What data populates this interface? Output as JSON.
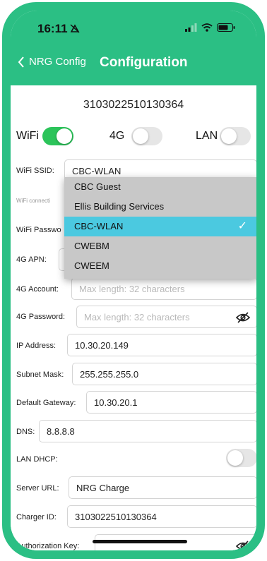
{
  "status": {
    "time": "16:11"
  },
  "nav": {
    "back_label": "NRG Config",
    "title": "Configuration"
  },
  "device_id": "3103022510130364",
  "toggles": {
    "wifi_label": "WiFi",
    "g4_label": "4G",
    "lan_label": "LAN",
    "wifi_on": true,
    "g4_on": false,
    "lan_on": false
  },
  "wifi_ssid": {
    "label": "WiFi SSID:",
    "value": "CBC-WLAN"
  },
  "wifi_note": "WiFi connecti",
  "wifi_password": {
    "label": "WiFi Passwo"
  },
  "g4_apn": {
    "label": "4G APN:"
  },
  "ssid_options": [
    {
      "label": "CBC Guest",
      "selected": false
    },
    {
      "label": "Ellis Building Services",
      "selected": false
    },
    {
      "label": "CBC-WLAN",
      "selected": true
    },
    {
      "label": "CWEBM",
      "selected": false
    },
    {
      "label": "CWEEM",
      "selected": false
    }
  ],
  "g4_account": {
    "label": "4G Account:",
    "placeholder": "Max length: 32 characters"
  },
  "g4_password": {
    "label": "4G Password:",
    "placeholder": "Max length: 32 characters"
  },
  "ip_address": {
    "label": "IP Address:",
    "value": "10.30.20.149"
  },
  "subnet_mask": {
    "label": "Subnet Mask:",
    "value": "255.255.255.0"
  },
  "default_gateway": {
    "label": "Default Gateway:",
    "value": "10.30.20.1"
  },
  "dns": {
    "label": "DNS:",
    "value": "8.8.8.8"
  },
  "lan_dhcp": {
    "label": "LAN DHCP:",
    "on": false
  },
  "server_url": {
    "label": "Server URL:",
    "value": "NRG Charge"
  },
  "charger_id": {
    "label": "Charger ID:",
    "value": "3103022510130364"
  },
  "authorization_key": {
    "label": "Authorization Key:"
  },
  "colors": {
    "accent": "#2bbf84",
    "toggle_on": "#2cc45a",
    "selection": "#4bc9e0"
  }
}
